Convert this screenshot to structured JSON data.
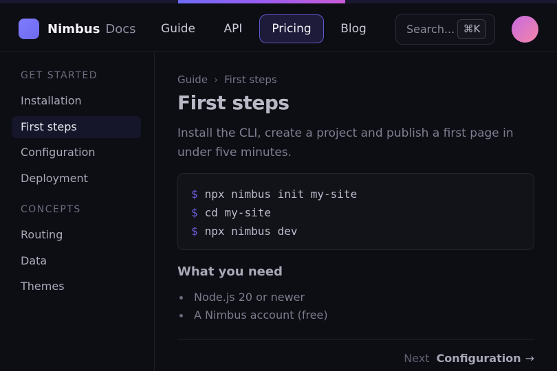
{
  "brand": {
    "name": "Nimbus",
    "subtitle": "Docs"
  },
  "nav": {
    "items": [
      {
        "label": "Guide"
      },
      {
        "label": "API"
      },
      {
        "label": "Pricing",
        "active": true
      },
      {
        "label": "Blog"
      }
    ]
  },
  "search": {
    "placeholder": "Search...",
    "shortcut": "⌘K"
  },
  "progress": {
    "start_fraction": 0.32,
    "end_fraction": 0.62
  },
  "sidebar": {
    "sections": [
      {
        "heading": "GET STARTED",
        "items": [
          {
            "label": "Installation"
          },
          {
            "label": "First steps",
            "active": true
          },
          {
            "label": "Configuration"
          },
          {
            "label": "Deployment"
          }
        ]
      },
      {
        "heading": "CONCEPTS",
        "items": [
          {
            "label": "Routing"
          },
          {
            "label": "Data"
          },
          {
            "label": "Themes"
          }
        ]
      }
    ]
  },
  "main": {
    "breadcrumb": [
      "Guide",
      "First steps"
    ],
    "breadcrumb_separator": "›",
    "title": "First steps",
    "lead": "Install the CLI, create a project and publish a first page in under five minutes.",
    "code": {
      "prompt": "$",
      "lines": [
        "npx nimbus init my-site",
        "cd my-site",
        "npx nimbus dev"
      ]
    },
    "section_title": "What you need",
    "requirements": [
      "Node.js 20 or newer",
      "A Nimbus account (free)"
    ],
    "next": {
      "label": "Next",
      "target": "Configuration",
      "arrow": "→"
    }
  },
  "colors": {
    "background": "#0d0d14",
    "accent": "#6d6cf7",
    "active_nav_bg": "#1e1b3a",
    "active_nav_border": "#5d59c9",
    "avatar_gradient_start": "#c86ae0",
    "avatar_gradient_end": "#f285a8"
  }
}
